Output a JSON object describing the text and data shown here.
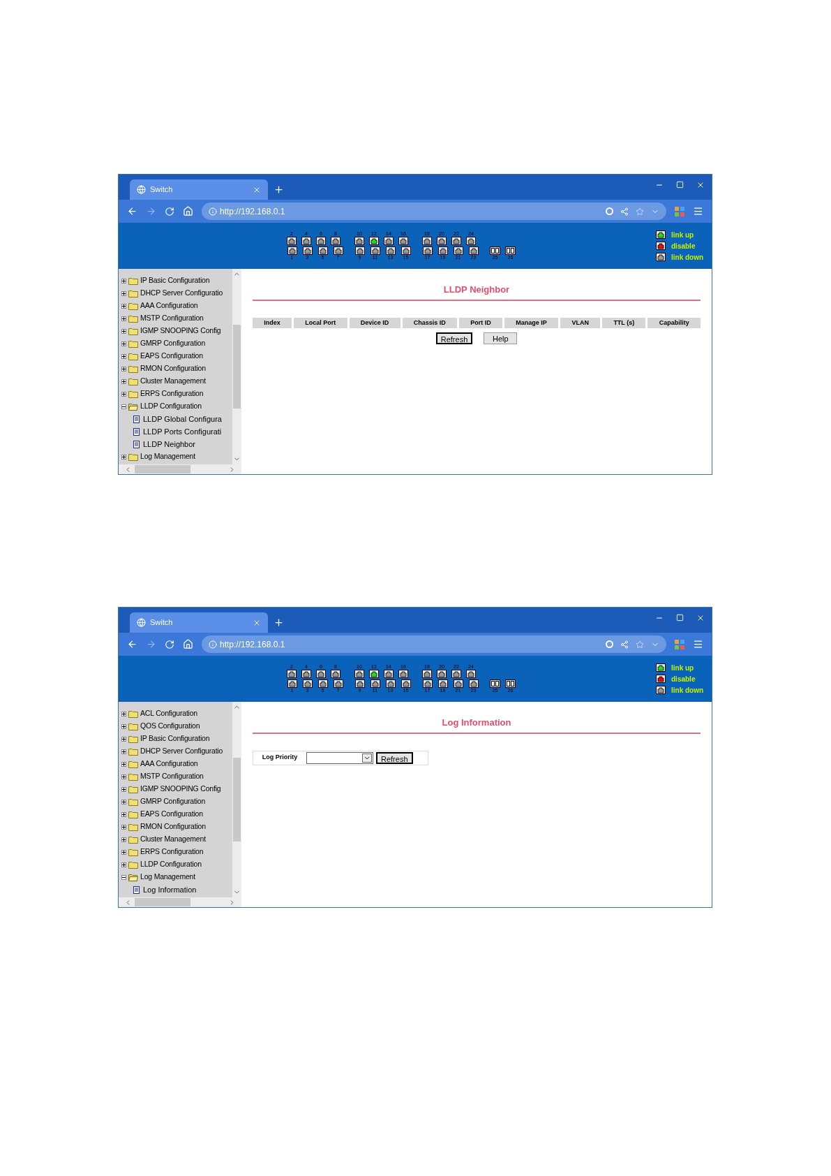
{
  "windows": [
    {
      "tab": {
        "title": "Switch"
      },
      "address": {
        "url": "http://192.168.0.1"
      },
      "banner": {
        "port_groups": [
          {
            "top": [
              {
                "label": "2",
                "kind": "down"
              },
              {
                "label": "4",
                "kind": "down"
              },
              {
                "label": "6",
                "kind": "down"
              },
              {
                "label": "8",
                "kind": "down"
              }
            ],
            "bottom": [
              {
                "label": "1",
                "kind": "down"
              },
              {
                "label": "3",
                "kind": "down"
              },
              {
                "label": "5",
                "kind": "down"
              },
              {
                "label": "7",
                "kind": "down"
              }
            ]
          },
          {
            "top": [
              {
                "label": "10",
                "kind": "down"
              },
              {
                "label": "12",
                "kind": "up"
              },
              {
                "label": "14",
                "kind": "down"
              },
              {
                "label": "16",
                "kind": "down"
              }
            ],
            "bottom": [
              {
                "label": "9",
                "kind": "down"
              },
              {
                "label": "11",
                "kind": "down"
              },
              {
                "label": "13",
                "kind": "down"
              },
              {
                "label": "15",
                "kind": "down"
              }
            ]
          },
          {
            "top": [
              {
                "label": "18",
                "kind": "down"
              },
              {
                "label": "20",
                "kind": "down"
              },
              {
                "label": "22",
                "kind": "down"
              },
              {
                "label": "24",
                "kind": "down"
              }
            ],
            "bottom": [
              {
                "label": "17",
                "kind": "down"
              },
              {
                "label": "19",
                "kind": "down"
              },
              {
                "label": "21",
                "kind": "down"
              },
              {
                "label": "23",
                "kind": "down"
              }
            ]
          },
          {
            "bottom": [
              {
                "label": "25",
                "kind": "fiber"
              },
              {
                "label": "26",
                "kind": "fiber"
              }
            ]
          }
        ],
        "legend": [
          {
            "kind": "up",
            "label": "link up"
          },
          {
            "kind": "disable",
            "label": "disable"
          },
          {
            "kind": "down",
            "label": "link down"
          }
        ]
      },
      "tree": [
        {
          "label": "IP Basic Configuration",
          "expanded": false
        },
        {
          "label": "DHCP Server Configuratio",
          "expanded": false
        },
        {
          "label": "AAA Configuration",
          "expanded": false
        },
        {
          "label": "MSTP Configuration",
          "expanded": false
        },
        {
          "label": "IGMP SNOOPING Config",
          "expanded": false
        },
        {
          "label": "GMRP Configuration",
          "expanded": false
        },
        {
          "label": "EAPS Configuration",
          "expanded": false
        },
        {
          "label": "RMON Configuration",
          "expanded": false
        },
        {
          "label": "Cluster Management",
          "expanded": false
        },
        {
          "label": "ERPS Configuration",
          "expanded": false
        },
        {
          "label": "LLDP Configuration",
          "expanded": true,
          "children": [
            {
              "label": "LLDP Global Configura"
            },
            {
              "label": "LLDP Ports Configurati"
            },
            {
              "label": "LLDP Neighbor"
            }
          ]
        },
        {
          "label": "Log Management",
          "expanded": false
        }
      ],
      "content": {
        "kind": "table",
        "title": "LLDP Neighbor",
        "columns": [
          "Index",
          "Local Port",
          "Device ID",
          "Chassis ID",
          "Port ID",
          "Manage IP",
          "VLAN",
          "TTL (s)",
          "Capability"
        ],
        "buttons": [
          {
            "label": "Refresh",
            "focused": true
          },
          {
            "label": "Help",
            "focused": false
          }
        ]
      }
    },
    {
      "tab": {
        "title": "Switch"
      },
      "address": {
        "url": "http://192.168.0.1"
      },
      "banner": {
        "port_groups": [
          {
            "top": [
              {
                "label": "2",
                "kind": "down"
              },
              {
                "label": "4",
                "kind": "down"
              },
              {
                "label": "6",
                "kind": "down"
              },
              {
                "label": "8",
                "kind": "down"
              }
            ],
            "bottom": [
              {
                "label": "1",
                "kind": "down"
              },
              {
                "label": "3",
                "kind": "down"
              },
              {
                "label": "5",
                "kind": "down"
              },
              {
                "label": "7",
                "kind": "down"
              }
            ]
          },
          {
            "top": [
              {
                "label": "10",
                "kind": "down"
              },
              {
                "label": "12",
                "kind": "up"
              },
              {
                "label": "14",
                "kind": "down"
              },
              {
                "label": "16",
                "kind": "down"
              }
            ],
            "bottom": [
              {
                "label": "9",
                "kind": "down"
              },
              {
                "label": "11",
                "kind": "down"
              },
              {
                "label": "13",
                "kind": "down"
              },
              {
                "label": "15",
                "kind": "down"
              }
            ]
          },
          {
            "top": [
              {
                "label": "18",
                "kind": "down"
              },
              {
                "label": "20",
                "kind": "down"
              },
              {
                "label": "22",
                "kind": "down"
              },
              {
                "label": "24",
                "kind": "down"
              }
            ],
            "bottom": [
              {
                "label": "17",
                "kind": "down"
              },
              {
                "label": "19",
                "kind": "down"
              },
              {
                "label": "21",
                "kind": "down"
              },
              {
                "label": "23",
                "kind": "down"
              }
            ]
          },
          {
            "bottom": [
              {
                "label": "25",
                "kind": "fiber"
              },
              {
                "label": "26",
                "kind": "fiber"
              }
            ]
          }
        ],
        "legend": [
          {
            "kind": "up",
            "label": "link up"
          },
          {
            "kind": "disable",
            "label": "disable"
          },
          {
            "kind": "down",
            "label": "link down"
          }
        ]
      },
      "tree": [
        {
          "label": "ACL Configuration",
          "expanded": false
        },
        {
          "label": "QOS Configuration",
          "expanded": false
        },
        {
          "label": "IP Basic Configuration",
          "expanded": false
        },
        {
          "label": "DHCP Server Configuratio",
          "expanded": false
        },
        {
          "label": "AAA Configuration",
          "expanded": false
        },
        {
          "label": "MSTP Configuration",
          "expanded": false
        },
        {
          "label": "IGMP SNOOPING Config",
          "expanded": false
        },
        {
          "label": "GMRP Configuration",
          "expanded": false
        },
        {
          "label": "EAPS Configuration",
          "expanded": false
        },
        {
          "label": "RMON Configuration",
          "expanded": false
        },
        {
          "label": "Cluster Management",
          "expanded": false
        },
        {
          "label": "ERPS Configuration",
          "expanded": false
        },
        {
          "label": "LLDP Configuration",
          "expanded": false
        },
        {
          "label": "Log Management",
          "expanded": true,
          "children": [
            {
              "label": "Log Information"
            }
          ]
        }
      ],
      "content": {
        "kind": "form",
        "title": "Log Information",
        "field_label": "Log Priority",
        "buttons": [
          {
            "label": "Refresh",
            "focused": true
          }
        ]
      }
    }
  ]
}
